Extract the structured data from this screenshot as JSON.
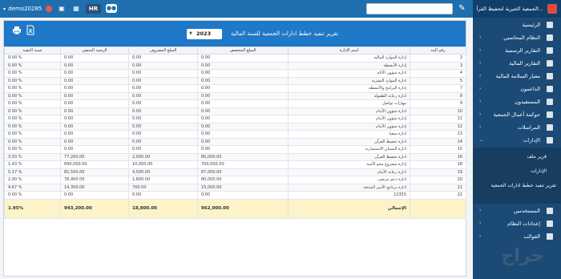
{
  "topbar": {
    "brand": "الجمعية الخيرية لتحفيظ القرآ...",
    "username": "demo20285",
    "hr_label": "HR",
    "search_placeholder": ""
  },
  "sidebar": {
    "items": [
      {
        "label": "الرئيسية"
      },
      {
        "label": "النظام المحاسبي"
      },
      {
        "label": "التقارير الرسمية"
      },
      {
        "label": "التقارير المالية"
      },
      {
        "label": "معيار السلامة المالية"
      },
      {
        "label": "الداعمون"
      },
      {
        "label": "المستفيدون"
      },
      {
        "label": "حوكمة أعمال الجمعية"
      },
      {
        "label": "المراسلات"
      },
      {
        "label": "الإدارات"
      }
    ],
    "submenu": [
      {
        "label": "قرير ملف"
      },
      {
        "label": "الإدارات"
      },
      {
        "label": "تقرير تنفيذ خطط ادارات الجمعية"
      }
    ],
    "lower": [
      {
        "label": "المستخدمين"
      },
      {
        "label": "إعدادات النظام"
      },
      {
        "label": "القوالب"
      }
    ]
  },
  "report": {
    "title": "تقرير تنفيذ خطط ادارات الجمعية للسنة المالية",
    "year": "2023"
  },
  "table": {
    "headers": [
      "رقم البند",
      "اسم الإدارة",
      "المبلغ المخصص",
      "المبلغ المصروف",
      "الرصيد المتبقي",
      "نسبة التنفيذ"
    ],
    "rows": [
      [
        "2",
        "إدارة الموارد المالية",
        "0.00",
        "0.00",
        "0.00",
        "% 0.00"
      ],
      [
        "3",
        "إدارة الأنشطة",
        "0.00",
        "0.00",
        "0.00",
        "% 0.00"
      ],
      [
        "4",
        "ادارة شؤون الأنام",
        "0.00",
        "0.00",
        "0.00",
        "% 0.00"
      ],
      [
        "5",
        "ادارة الموارد البشرية",
        "0.00",
        "0.00",
        "0.00",
        "% 0.00"
      ],
      [
        "7",
        "إدارة البرامج والأنشطة",
        "0.00",
        "0.00",
        "0.00",
        "% 0.00"
      ],
      [
        "8",
        "ادارة رعاية الطفولة",
        "0.00",
        "0.00",
        "0.00",
        "% 0.00"
      ],
      [
        "9",
        "مهارات تواصل",
        "0.00",
        "0.00",
        "0.00",
        "% 0.00"
      ],
      [
        "10",
        "ادارة شؤون الأيتام",
        "0.00",
        "0.00",
        "0.00",
        "% 0.00"
      ],
      [
        "11",
        "إدارة شؤون الأيتام",
        "0.00",
        "0.00",
        "0.00",
        "% 0.00"
      ],
      [
        "12",
        "إدارة شؤون الأيتام",
        "0.00",
        "0.00",
        "0.00",
        "% 0.00"
      ],
      [
        "13",
        "ادارة سقيا",
        "0.00",
        "0.00",
        "0.00",
        "% 0.00"
      ],
      [
        "14",
        "ادارة تحفيظ القرآن",
        "0.00",
        "0.00",
        "0.00",
        "% 0.00"
      ],
      [
        "15",
        "ادارة البستان الاستثمارية",
        "0.00",
        "0.00",
        "0.00",
        "% 0.00"
      ],
      [
        "16",
        "ادارة تحفيظ القرآن",
        "80,000.00",
        "2,000.00",
        "77,200.00",
        "% 3.50"
      ],
      [
        "18",
        "إدارة مشروع محو الأمية",
        "700,000.00",
        "10,000.00",
        "690,000.00",
        "% 1.43"
      ],
      [
        "19",
        "ادارة رعاية الأيتام",
        "87,000.00",
        "4,500.00",
        "82,500.00",
        "% 5.17"
      ],
      [
        "20",
        "ادارة دعم مرضى",
        "80,000.00",
        "1,600.00",
        "78,400.00",
        "% 2.00"
      ],
      [
        "21",
        "ادارة برنامج الأسر المنتجة",
        "15,000.00",
        "700.00",
        "14,300.00",
        "% 4.67"
      ],
      [
        "22",
        "12355",
        "0.00",
        "0.00",
        "0.00",
        "% 0.00"
      ]
    ],
    "total": {
      "label": "الإجمالي",
      "allocated": "962,000.00",
      "spent": "18,800.00",
      "remaining": "943,200.00",
      "ratio": "1.95%"
    }
  },
  "watermark": "حراج",
  "colors": {
    "topbar": "#1f6fae",
    "sidebar": "#1b4a76",
    "panel_header": "#1f78c8",
    "total_row": "#fcf3c8"
  }
}
